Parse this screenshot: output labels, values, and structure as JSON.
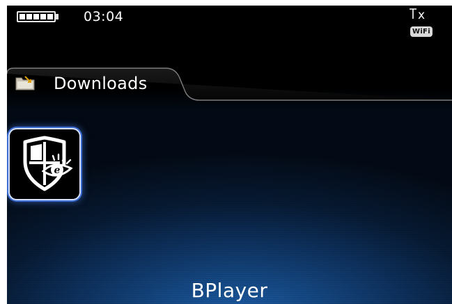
{
  "status": {
    "time": "03:04",
    "signal_text": "x",
    "wifi_label": "WiFi",
    "battery_cells": 5
  },
  "folder_tab": {
    "label": "Downloads"
  },
  "selected_app": {
    "name": "BPlayer"
  },
  "colors": {
    "accent": "#3d6ed6",
    "background_center": "#1f5ea8",
    "text": "#ffffff"
  }
}
